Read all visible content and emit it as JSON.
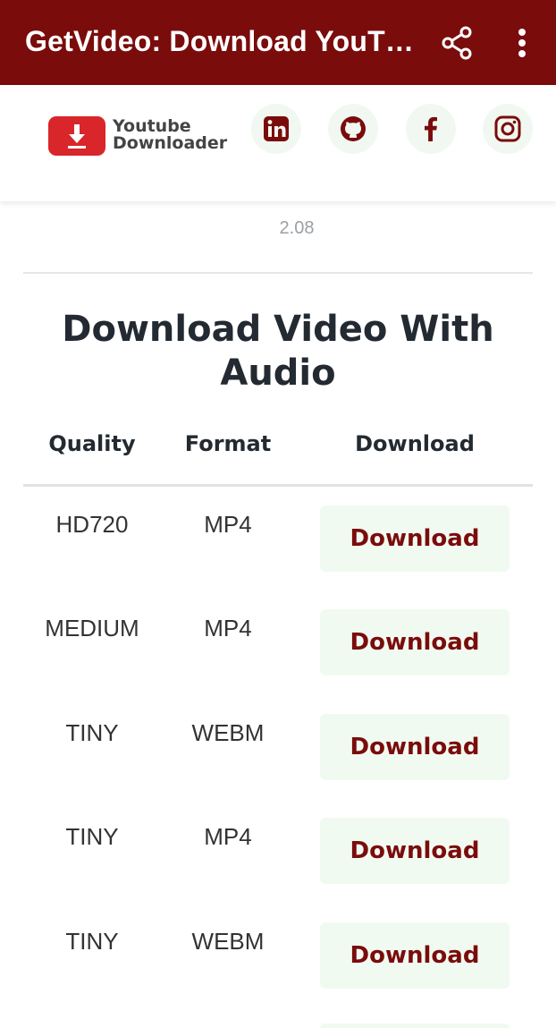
{
  "appbar": {
    "title": "GetVideo: Download YouT…",
    "share_icon": "share-icon",
    "menu_icon": "more-vert-icon",
    "color": "#7a0c0c"
  },
  "header": {
    "logo": {
      "line1": "Youtube",
      "line2": "Downloader",
      "icon": "download-icon",
      "badge_color": "#d8262b"
    },
    "social": [
      {
        "name": "linkedin",
        "icon": "linkedin-icon"
      },
      {
        "name": "github",
        "icon": "github-icon"
      },
      {
        "name": "facebook",
        "icon": "facebook-icon"
      },
      {
        "name": "instagram",
        "icon": "instagram-icon"
      }
    ]
  },
  "version": "2.08",
  "section": {
    "title_line1": "Download Video With",
    "title_line2": "Audio",
    "columns": {
      "quality": "Quality",
      "format": "Format",
      "download": "Download"
    }
  },
  "rows": [
    {
      "quality": "HD720",
      "format": "MP4",
      "action": "Download"
    },
    {
      "quality": "MEDIUM",
      "format": "MP4",
      "action": "Download"
    },
    {
      "quality": "TINY",
      "format": "WEBM",
      "action": "Download"
    },
    {
      "quality": "TINY",
      "format": "MP4",
      "action": "Download"
    },
    {
      "quality": "TINY",
      "format": "WEBM",
      "action": "Download"
    }
  ]
}
